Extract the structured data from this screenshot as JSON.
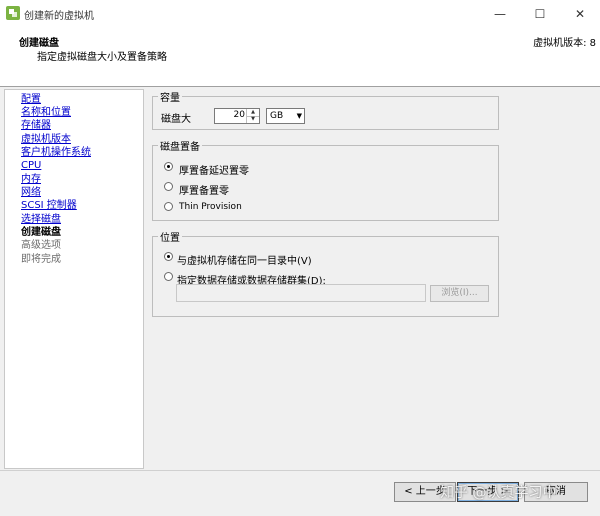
{
  "window": {
    "title": "创建新的虚拟机",
    "controls": {
      "minimize": "—",
      "maximize": "☐",
      "close": "✕"
    }
  },
  "header": {
    "title": "创建磁盘",
    "subtitle": "指定虚拟磁盘大小及置备策略",
    "version": "虚拟机版本: 8"
  },
  "nav": {
    "items": [
      {
        "label": "配置",
        "state": "link"
      },
      {
        "label": "名称和位置",
        "state": "link"
      },
      {
        "label": "存储器",
        "state": "link"
      },
      {
        "label": "虚拟机版本",
        "state": "link"
      },
      {
        "label": "客户机操作系统",
        "state": "link"
      },
      {
        "label": "CPU",
        "state": "link"
      },
      {
        "label": "内存",
        "state": "link"
      },
      {
        "label": "网络",
        "state": "link"
      },
      {
        "label": "SCSI 控制器",
        "state": "link"
      },
      {
        "label": "选择磁盘",
        "state": "link"
      },
      {
        "label": "创建磁盘",
        "state": "current"
      },
      {
        "label": "高级选项",
        "state": "disabled"
      },
      {
        "label": "即将完成",
        "state": "disabled"
      }
    ]
  },
  "capacity": {
    "group_title": "容量",
    "disk_size_label": "磁盘大",
    "disk_size_value": "20",
    "unit": "GB"
  },
  "provisioning": {
    "group_title": "磁盘置备",
    "options": [
      {
        "label": "厚置备延迟置零",
        "checked": true
      },
      {
        "label": "厚置备置零",
        "checked": false
      },
      {
        "label": "Thin Provision",
        "checked": false
      }
    ]
  },
  "location": {
    "group_title": "位置",
    "options": [
      {
        "label": "与虚拟机存储在同一目录中(V)",
        "checked": true
      },
      {
        "label": "指定数据存储或数据存储群集(D):",
        "checked": false
      }
    ],
    "path_value": "",
    "browse_label": "浏览(I)..."
  },
  "footer": {
    "back_label": "< 上一步",
    "next_label": "下一步 >",
    "cancel_label": "取消"
  },
  "watermark": "知乎 @认真学习中"
}
